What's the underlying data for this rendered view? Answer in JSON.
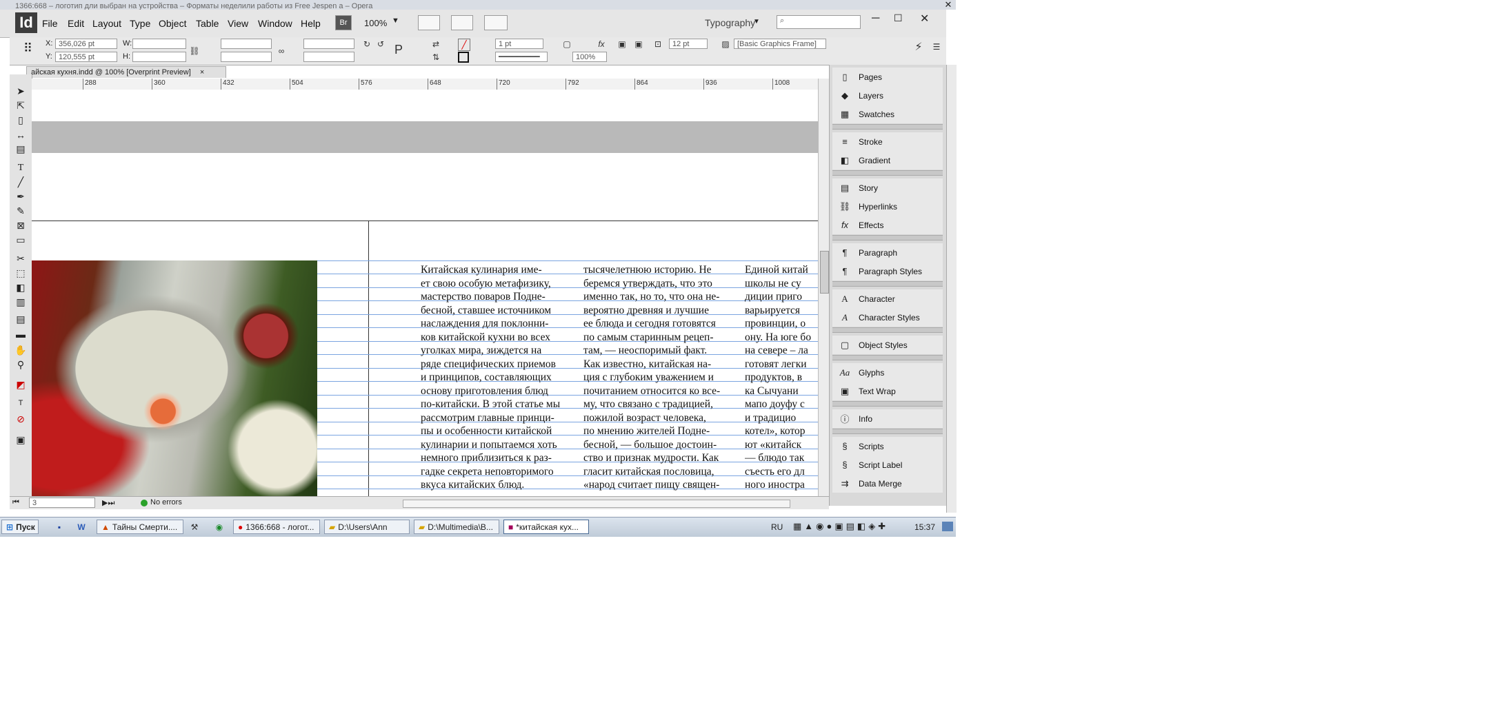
{
  "titlebar": {
    "text": "1366:668 – логотип дли выбран на устройства – Форматы неделили работы из Free Jespen a – Opera"
  },
  "app": {
    "logo": "Id",
    "zoom_value": "100%",
    "workspace": "Typography",
    "search_placeholder": ""
  },
  "menu": [
    "File",
    "Edit",
    "Layout",
    "Type",
    "Object",
    "Table",
    "View",
    "Window",
    "Help"
  ],
  "bridge_label": "Br",
  "control": {
    "x_label": "X:",
    "x_value": "356,026 pt",
    "y_label": "Y:",
    "y_value": "120,555 pt",
    "w_label": "W:",
    "h_label": "H:",
    "stroke_weight": "1 pt",
    "opacity": "100%",
    "ref_size": "12 pt",
    "frame_style": "[Basic Graphics Frame]"
  },
  "doc_tab": {
    "title": "айская кухня.indd @ 100% [Overprint Preview]"
  },
  "ruler": {
    "labels": [
      "288",
      "360",
      "432",
      "504",
      "576",
      "648",
      "720",
      "792",
      "864",
      "936",
      "1008"
    ]
  },
  "text_columns": [
    "Китайская кулинария име-\nет свою особую метафизику,\nмастерство поваров Подне-\nбесной, ставшее источником\nнаслаждения для поклонни-\nков китайской кухни во всех\nуголках мира, зиждется на\nряде специфических приемов\nи принципов, составляющих\nоснову приготовления блюд\nпо-китайски. В этой статье мы\nрассмотрим главные принци-\nпы и особенности китайской\nкулинарии и попытаемся хоть\nнемного приблизиться к раз-\nгадке секрета неповторимого\nвкуса китайских блюд.",
    "тысячелетнюю историю. Не\nберемся утверждать, что это\nименно так, но то, что она не-\nвероятно древняя и лучшие\nее блюда и сегодня готовятся\nпо самым старинным рецеп-\nтам, — неоспоримый факт.\nКак известно, китайская на-\nция с глубоким уважением и\nпочитанием относится ко все-\nму, что связано с традицией,\nпожилой возраст человека,\nпо мнению жителей Подне-\nбесной, — большое достоин-\nство и признак мудрости. Как\nгласит китайская пословица,\n«народ считает пищу священ-",
    "Единой китай\nшколы не су\nдиции приго\nварьируется\nпровинции, о\nону. На юге бо\nна севере – ла\nготовят легки\nпродуктов, в\nка Сычуани\nмапо доуфу с\nи традицио\nкотел», котор\nют «китайск\n— блюдо так\nсъесть его дл\nного иностра"
  ],
  "status": {
    "page": "3",
    "errors": "No errors"
  },
  "panels": [
    {
      "label": "Pages",
      "icon": "pages-icon"
    },
    {
      "label": "Layers",
      "icon": "layers-icon"
    },
    {
      "label": "Swatches",
      "icon": "swatches-icon"
    },
    {
      "label": "Stroke",
      "icon": "stroke-icon"
    },
    {
      "label": "Gradient",
      "icon": "gradient-icon"
    },
    {
      "label": "Story",
      "icon": "story-icon"
    },
    {
      "label": "Hyperlinks",
      "icon": "hyperlinks-icon"
    },
    {
      "label": "Effects",
      "icon": "effects-icon"
    },
    {
      "label": "Paragraph",
      "icon": "paragraph-icon"
    },
    {
      "label": "Paragraph Styles",
      "icon": "paragraph-styles-icon"
    },
    {
      "label": "Character",
      "icon": "character-icon"
    },
    {
      "label": "Character Styles",
      "icon": "character-styles-icon"
    },
    {
      "label": "Object Styles",
      "icon": "object-styles-icon"
    },
    {
      "label": "Glyphs",
      "icon": "glyphs-icon"
    },
    {
      "label": "Text Wrap",
      "icon": "text-wrap-icon"
    },
    {
      "label": "Info",
      "icon": "info-icon"
    },
    {
      "label": "Scripts",
      "icon": "scripts-icon"
    },
    {
      "label": "Script Label",
      "icon": "script-label-icon"
    },
    {
      "label": "Data Merge",
      "icon": "data-merge-icon"
    }
  ],
  "taskbar": {
    "start": "Пуск",
    "tasks": [
      "Тайны Смерти....",
      "1366:668 - логот...",
      "D:\\Users\\Ann",
      "D:\\Multimedia\\B...",
      "*китайская кух..."
    ],
    "lang": "RU",
    "clock": "15:37"
  }
}
